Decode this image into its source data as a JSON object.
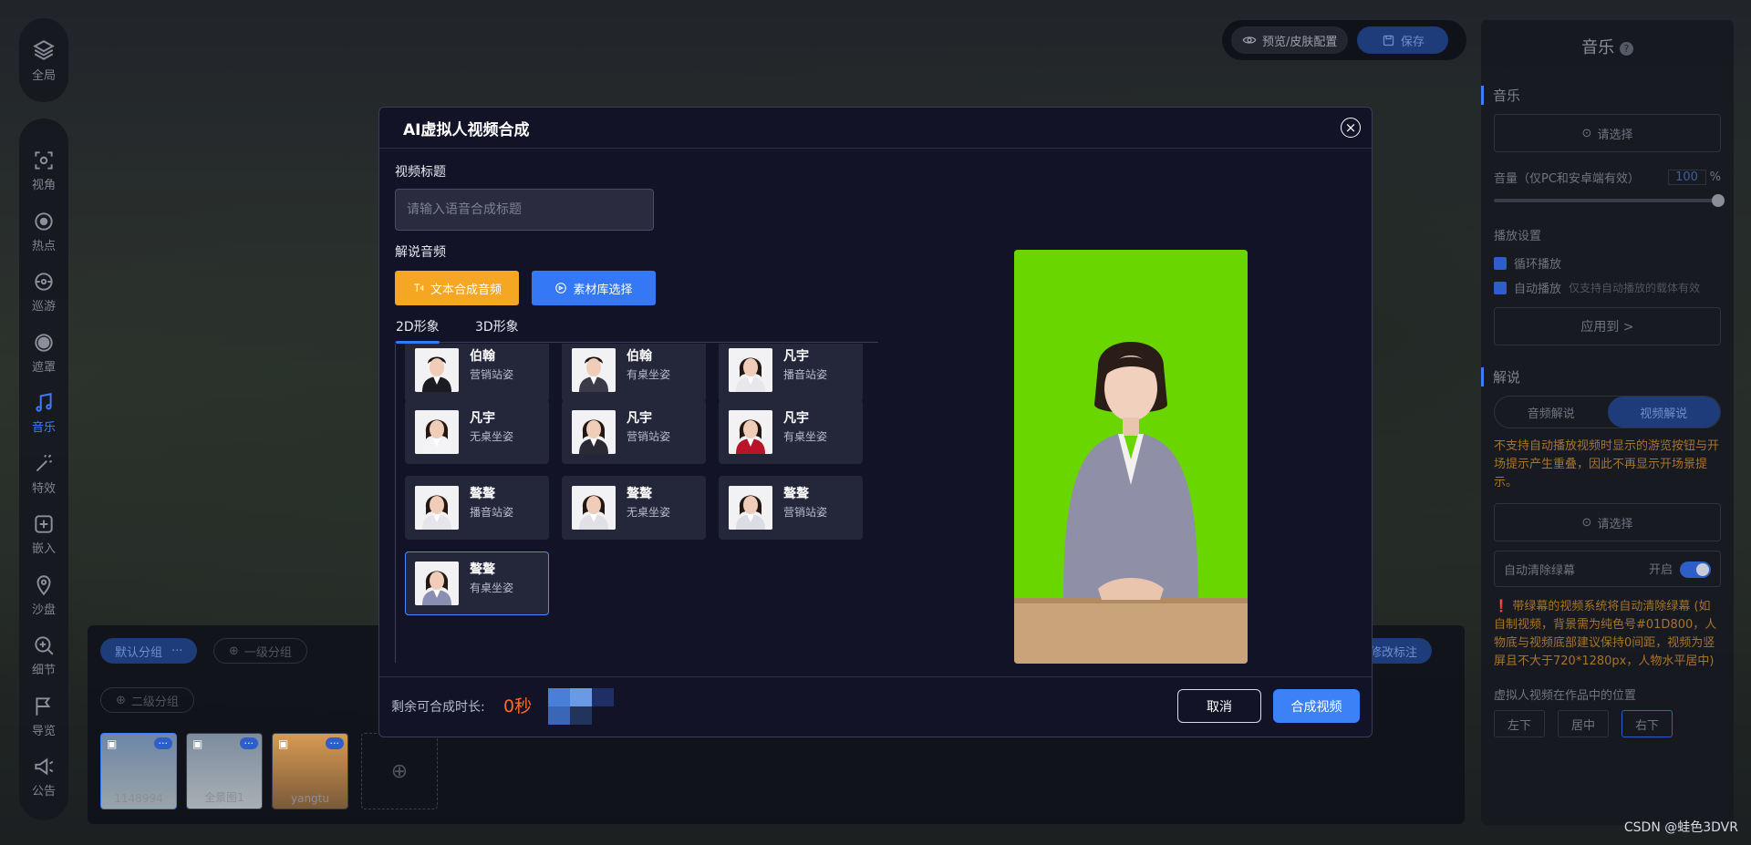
{
  "left_top": {
    "label": "全局"
  },
  "toolbar": [
    {
      "key": "view",
      "label": "视角",
      "icon": "view-icon",
      "active": false
    },
    {
      "key": "hotspot",
      "label": "热点",
      "icon": "hotspot-icon",
      "active": false
    },
    {
      "key": "tour",
      "label": "巡游",
      "icon": "tour-icon",
      "active": false
    },
    {
      "key": "mask",
      "label": "遮罩",
      "icon": "mask-icon",
      "active": false
    },
    {
      "key": "music",
      "label": "音乐",
      "icon": "music-icon",
      "active": true
    },
    {
      "key": "effects",
      "label": "特效",
      "icon": "effects-icon",
      "active": false
    },
    {
      "key": "embed",
      "label": "嵌入",
      "icon": "embed-icon",
      "active": false
    },
    {
      "key": "sandbox",
      "label": "沙盘",
      "icon": "sandbox-icon",
      "active": false
    },
    {
      "key": "detail",
      "label": "细节",
      "icon": "detail-icon",
      "active": false
    },
    {
      "key": "guide",
      "label": "导览",
      "icon": "guide-icon",
      "active": false
    },
    {
      "key": "notice",
      "label": "公告",
      "icon": "notice-icon",
      "active": false
    }
  ],
  "top_actions": {
    "preview_label": "预览/皮肤配置",
    "save_label": "保存"
  },
  "right_panel": {
    "title": "音乐",
    "music_section": "音乐",
    "select_label": "请选择",
    "volume_label": "音量（仅PC和安卓端有效）",
    "volume_value": "100",
    "volume_unit": "%",
    "play_settings": "播放设置",
    "loop_label": "循环播放",
    "autoplay_label": "自动播放",
    "autoplay_hint": "仅支持自动播放的载体有效",
    "apply_to": "应用到 >",
    "narration_section": "解说",
    "seg_audio": "音频解说",
    "seg_video": "视频解说",
    "narration_warning": "不支持自动播放视频时显示的游览按钮与开场提示产生重叠，因此不再显示开场景提示。",
    "select_label_2": "请选择",
    "auto_green_label": "自动清除绿幕",
    "auto_green_state": "开启",
    "green_note": "带绿幕的视频系统将自动清除绿幕 (如自制视频，背景需为纯色号#01D800，人物底与视频底部建议保持0间距，视频为竖屏且不大于720*1280px，人物水平居中)",
    "position_label": "虚拟人视频在作品中的位置",
    "pos_left": "左下",
    "pos_center": "居中",
    "pos_right": "右下"
  },
  "bottom_strip": {
    "group_default": "默认分组",
    "group_level1": "一级分组",
    "group_level2": "二级分组",
    "edit_label": "修改标注",
    "scenes": [
      {
        "caption": "1148994",
        "colors": [
          "#6c86a6",
          "#9aa4a8"
        ]
      },
      {
        "caption": "全景图1",
        "colors": [
          "#7d8c9e",
          "#a8b0b4"
        ]
      },
      {
        "caption": "yangtu",
        "colors": [
          "#d89a52",
          "#7a5a3a"
        ]
      }
    ]
  },
  "modal": {
    "title": "AI虚拟人视频合成",
    "video_title_label": "视频标题",
    "video_title_placeholder": "请输入语音合成标题",
    "narration_audio_label": "解说音频",
    "btn_tts": "文本合成音频",
    "btn_library": "素材库选择",
    "tab_2d": "2D形象",
    "tab_3d": "3D形象",
    "avatars": [
      {
        "name": "伯翰",
        "pose": "营销站姿",
        "gender": "m",
        "outfit": "#1b1b22"
      },
      {
        "name": "伯翰",
        "pose": "有桌坐姿",
        "gender": "m",
        "outfit": "#3a3a48"
      },
      {
        "name": "凡宇",
        "pose": "播音站姿",
        "gender": "f",
        "outfit": "#e8e8ec"
      },
      {
        "name": "凡宇",
        "pose": "无桌坐姿",
        "gender": "f",
        "outfit": "#f4f4f6"
      },
      {
        "name": "凡宇",
        "pose": "营销站姿",
        "gender": "f",
        "outfit": "#2a2a34"
      },
      {
        "name": "凡宇",
        "pose": "有桌坐姿",
        "gender": "f",
        "outfit": "#b8142a"
      },
      {
        "name": "聱聱",
        "pose": "播音站姿",
        "gender": "f",
        "outfit": "#e6e6ea"
      },
      {
        "name": "聱聱",
        "pose": "无桌坐姿",
        "gender": "f",
        "outfit": "#e0e0e6"
      },
      {
        "name": "聱聱",
        "pose": "营销站姿",
        "gender": "f",
        "outfit": "#dcdce4"
      },
      {
        "name": "聱聱",
        "pose": "有桌坐姿",
        "gender": "f",
        "outfit": "#8a8eb2",
        "selected": true
      }
    ],
    "remaining_label": "剩余可合成时长:",
    "remaining_value": "0秒",
    "btn_cancel": "取消",
    "btn_submit": "合成视频"
  },
  "watermark": "CSDN @蛙色3DVR"
}
